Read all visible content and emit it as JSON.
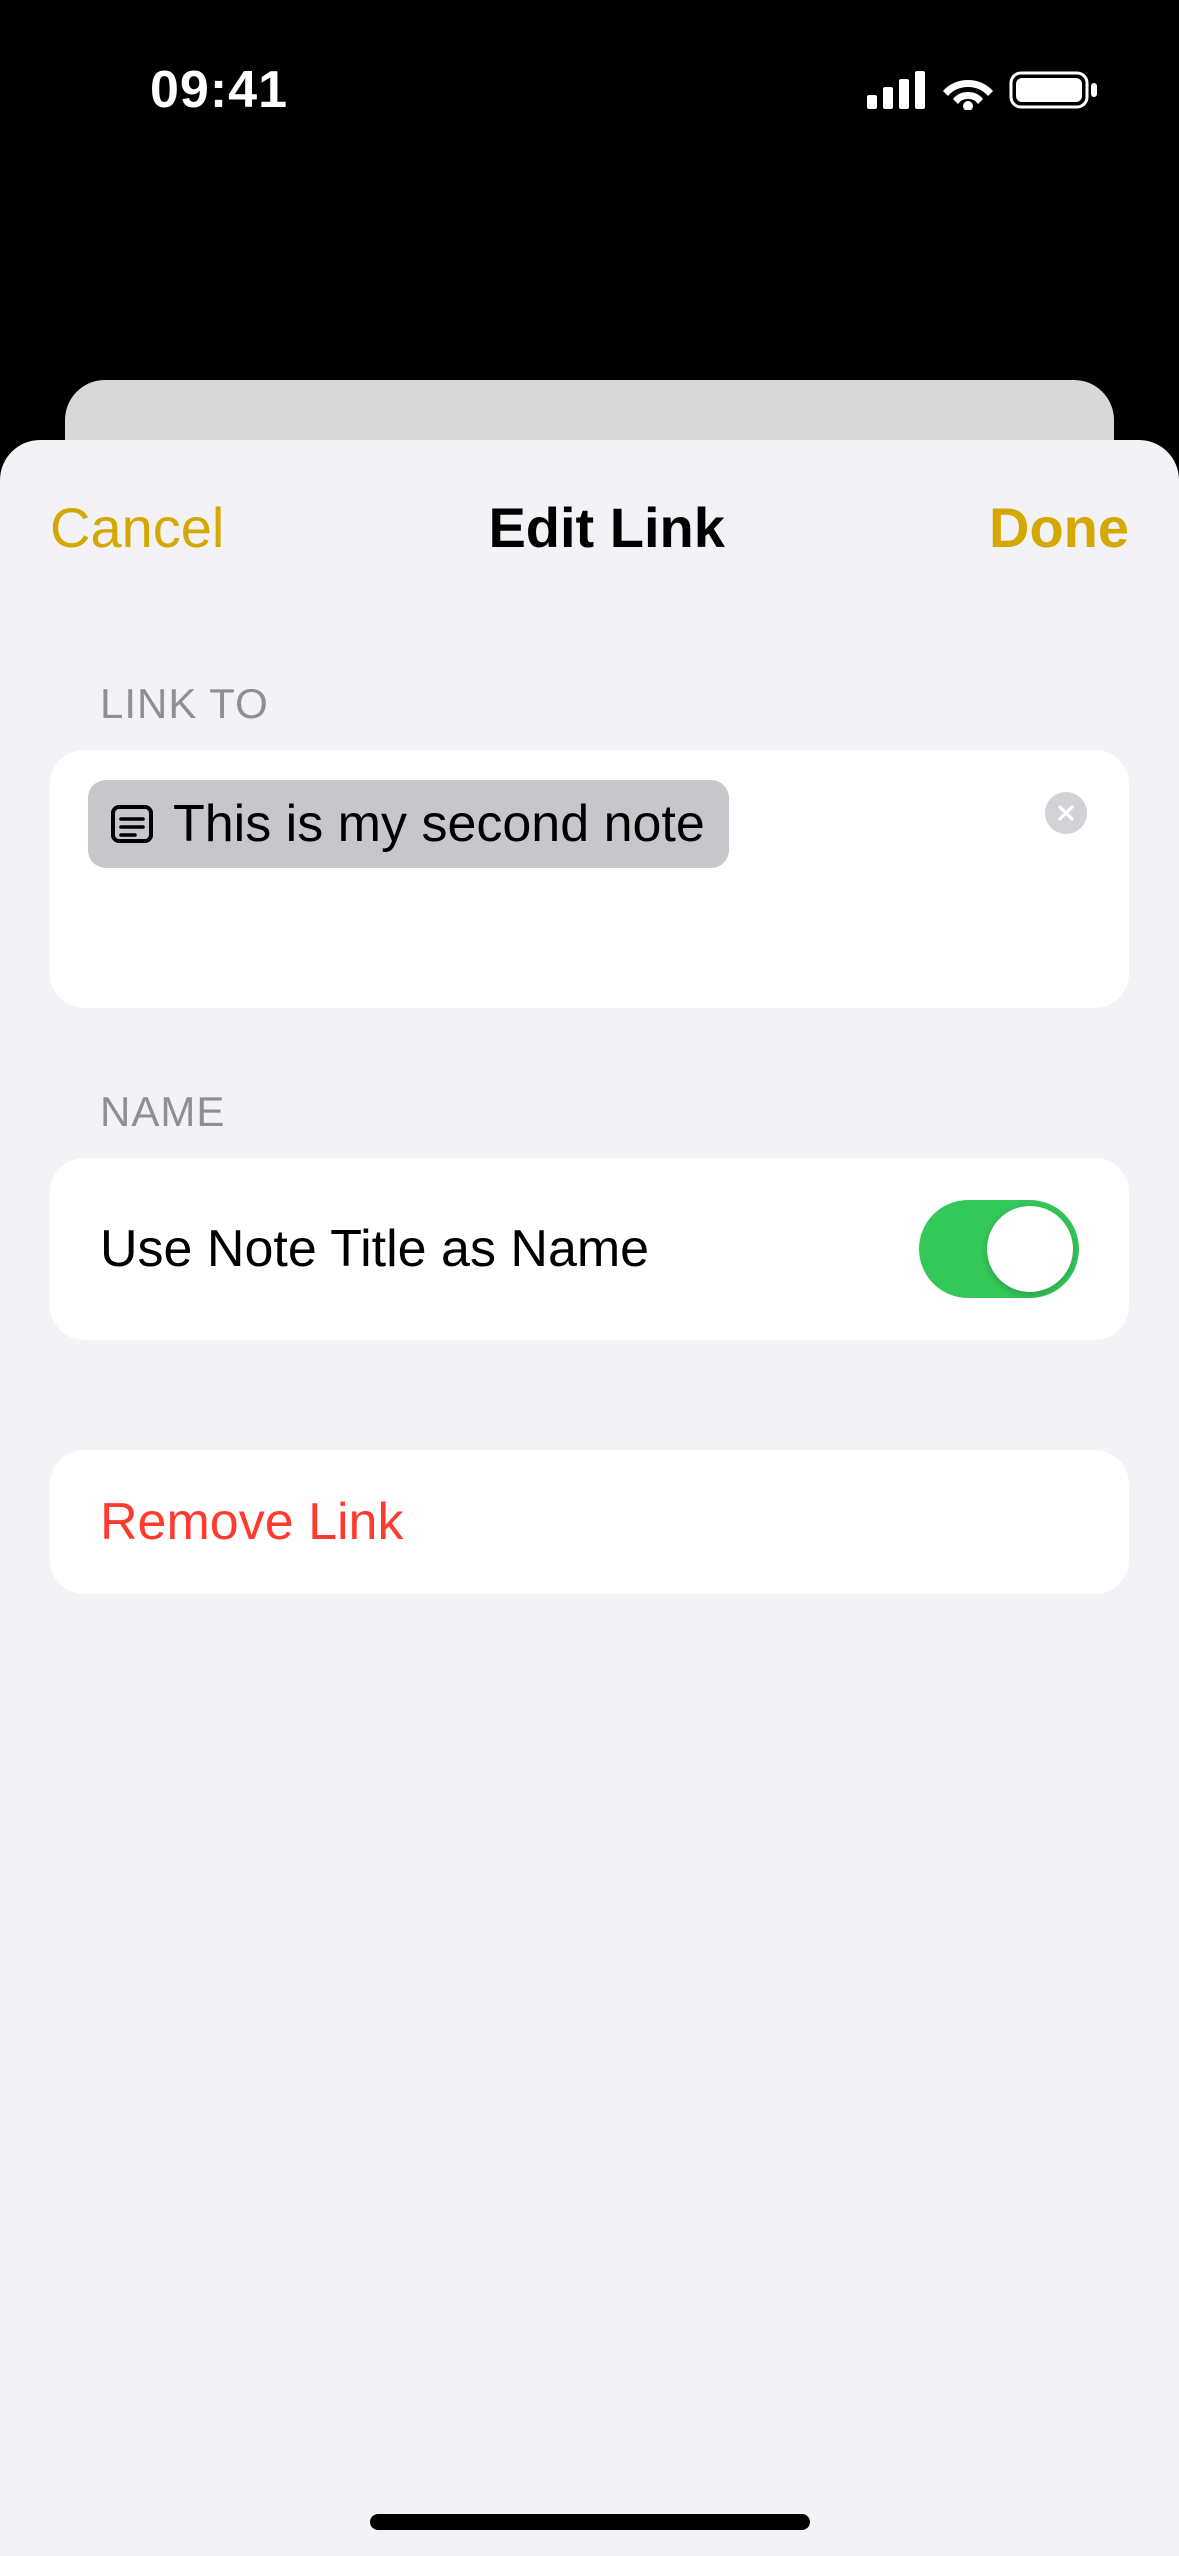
{
  "status": {
    "time": "09:41"
  },
  "nav": {
    "cancel": "Cancel",
    "title": "Edit Link",
    "done": "Done"
  },
  "sections": {
    "link_to": {
      "header": "LINK TO",
      "chip_text": "This is my second note"
    },
    "name": {
      "header": "NAME",
      "toggle_label": "Use Note Title as Name",
      "toggle_on": true
    },
    "remove": {
      "label": "Remove Link"
    }
  }
}
